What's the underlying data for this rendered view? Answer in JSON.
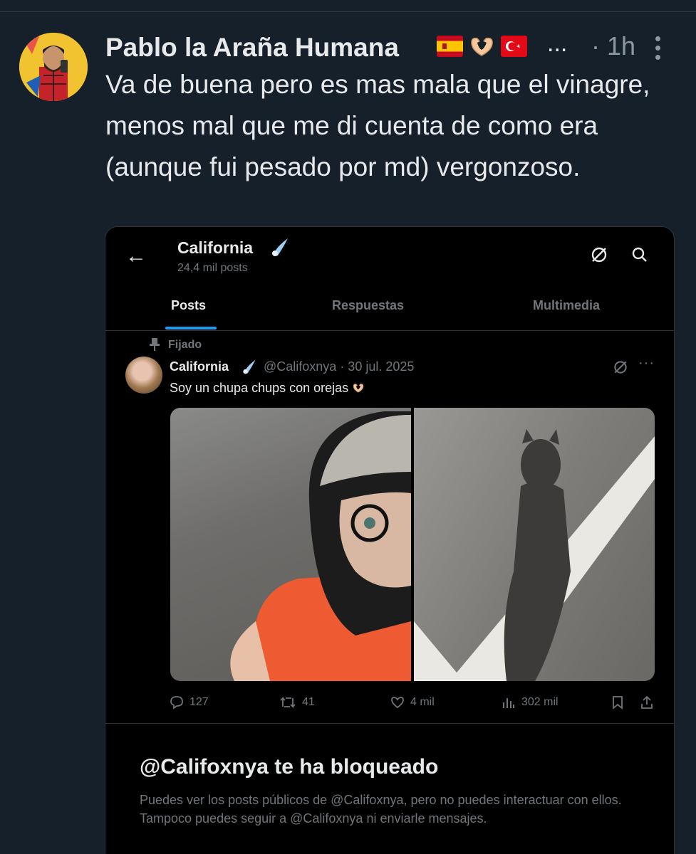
{
  "post": {
    "author_name": "Pablo la Araña Humana",
    "name_ellipsis": "...",
    "time": "· 1h",
    "text": "Va de buena pero es mas mala que el vinagre, menos mal que me di cuenta de como era (aunque fui pesado por md) vergonzoso."
  },
  "embed": {
    "back_icon": "←",
    "profile_name": "California",
    "post_count": "24,4 mil posts",
    "tabs": [
      "Posts",
      "Respuestas",
      "Multimedia"
    ],
    "pinned_label": "Fijado",
    "tweet": {
      "name": "California",
      "handle_date": "@Califoxnya · 30 jul. 2025",
      "more": "···",
      "text": "Soy un chupa chups con orejas",
      "replies": "127",
      "reposts": "41",
      "likes": "4 mil",
      "views": "302 mil"
    },
    "blocked_title": "@Califoxnya te ha bloqueado",
    "blocked_desc": "Puedes ver los posts públicos de @Califoxnya, pero no puedes interactuar con ellos. Tampoco puedes seguir a @Califoxnya ni enviarle mensajes."
  },
  "colors": {
    "background": "#15202b",
    "embed_background": "#000000",
    "accent": "#1d9bf0",
    "muted": "#71767b"
  }
}
